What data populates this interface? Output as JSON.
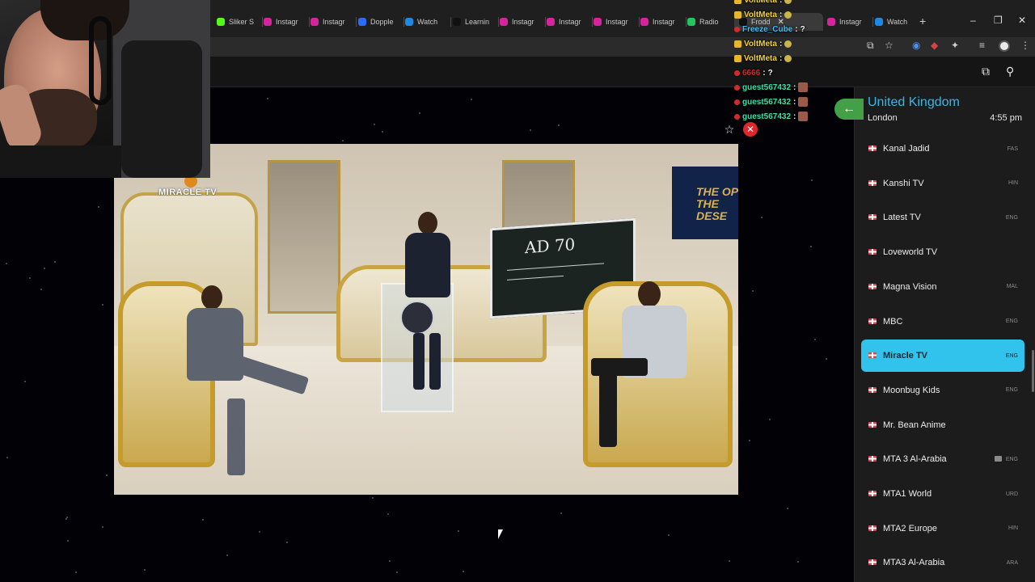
{
  "browser": {
    "tabs": [
      {
        "label": "Sliker S",
        "icon": "kick-icon",
        "color": "#53fc18"
      },
      {
        "label": "Instagr",
        "icon": "instagram-icon",
        "color": "#d6249f"
      },
      {
        "label": "Instagr",
        "icon": "instagram-icon",
        "color": "#d6249f"
      },
      {
        "label": "Dopple",
        "icon": "dopple-icon",
        "color": "#2b6cff"
      },
      {
        "label": "Watch",
        "icon": "watch-icon",
        "color": "#1e88e5"
      },
      {
        "label": "Learnin",
        "icon": "tiktok-icon",
        "color": "#111111"
      },
      {
        "label": "Instagr",
        "icon": "instagram-icon",
        "color": "#d6249f"
      },
      {
        "label": "Instagr",
        "icon": "instagram-icon",
        "color": "#d6249f"
      },
      {
        "label": "Instagr",
        "icon": "instagram-icon",
        "color": "#d6249f"
      },
      {
        "label": "Instagr",
        "icon": "instagram-icon",
        "color": "#d6249f"
      },
      {
        "label": "Radio",
        "icon": "radio-icon",
        "color": "#22c55e"
      },
      {
        "label": "Frodd",
        "icon": "x-icon",
        "color": "#111111"
      },
      {
        "label": "Instagr",
        "icon": "instagram-icon",
        "color": "#d6249f"
      },
      {
        "label": "Watch",
        "icon": "watch-icon",
        "color": "#1e88e5"
      }
    ],
    "window_controls": [
      "–",
      "❐",
      "✕"
    ]
  },
  "chat": [
    {
      "user": "VoltMeta",
      "message": "",
      "color": "#f5d13a",
      "badge": "crown",
      "emote": true
    },
    {
      "user": "VoltMeta",
      "message": "",
      "color": "#f5d13a",
      "badge": "crown",
      "emote": true
    },
    {
      "user": "Freeze_Cube",
      "message": "?",
      "color": "#3fc1ff",
      "badge": "dot",
      "emote": false
    },
    {
      "user": "VoltMeta",
      "message": "",
      "color": "#f5d13a",
      "badge": "crown",
      "emote": true
    },
    {
      "user": "VoltMeta",
      "message": "",
      "color": "#f5d13a",
      "badge": "crown",
      "emote": true
    },
    {
      "user": "6666",
      "message": "?",
      "color": "#d22c2c",
      "badge": "dot",
      "emote": false
    },
    {
      "user": "guest567432",
      "message": "",
      "color": "#3be0a7",
      "badge": "dot",
      "emote": "img"
    },
    {
      "user": "guest567432",
      "message": "",
      "color": "#3be0a7",
      "badge": "dot",
      "emote": "img"
    },
    {
      "user": "guest567432",
      "message": "",
      "color": "#3be0a7",
      "badge": "dot",
      "emote": "img"
    }
  ],
  "video": {
    "watermark": "MIRACLE TV",
    "board_text": "AD 70",
    "poster_text": "THE OP THE DESE"
  },
  "panel": {
    "country": "United Kingdom",
    "city": "London",
    "time": "4:55 pm",
    "channels": [
      {
        "name": "Kanal Jadid",
        "lang": "FAS",
        "active": false
      },
      {
        "name": "Kanshi TV",
        "lang": "HIN",
        "active": false
      },
      {
        "name": "Latest TV",
        "lang": "ENG",
        "active": false
      },
      {
        "name": "Loveworld TV",
        "lang": "",
        "active": false
      },
      {
        "name": "Magna Vision",
        "lang": "MAL",
        "active": false
      },
      {
        "name": "MBC",
        "lang": "ENG",
        "active": false
      },
      {
        "name": "Miracle TV",
        "lang": "ENG",
        "active": true
      },
      {
        "name": "Moonbug Kids",
        "lang": "ENG",
        "active": false
      },
      {
        "name": "Mr. Bean Anime",
        "lang": "",
        "active": false
      },
      {
        "name": "MTA 3 Al-Arabia",
        "lang": "ENG",
        "active": false,
        "video_icon": true
      },
      {
        "name": "MTA1 World",
        "lang": "URD",
        "active": false
      },
      {
        "name": "MTA2 Europe",
        "lang": "HIN",
        "active": false
      },
      {
        "name": "MTA3 Al-Arabia",
        "lang": "ARA",
        "active": false
      }
    ]
  },
  "colors": {
    "accent": "#35b8e8",
    "active_row": "#32c3ec",
    "back_button": "#43a047",
    "close_button": "#e0262b"
  }
}
